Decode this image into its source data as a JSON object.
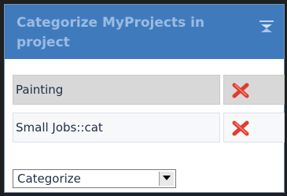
{
  "widget": {
    "title": "Categorize MyProjects in project",
    "collapse_icon": "collapse-arrows-icon",
    "colors": {
      "header_bg": "#3f7bbc",
      "title_text": "#9cbbe2",
      "delete_icon": "#e23b2e"
    }
  },
  "categories": [
    {
      "label": "Painting",
      "delete_icon": "delete-x-icon"
    },
    {
      "label": "Small Jobs::cat",
      "delete_icon": "delete-x-icon"
    }
  ],
  "categorize_select": {
    "selected": "Categorize",
    "arrow_icon": "dropdown-arrow-icon"
  }
}
